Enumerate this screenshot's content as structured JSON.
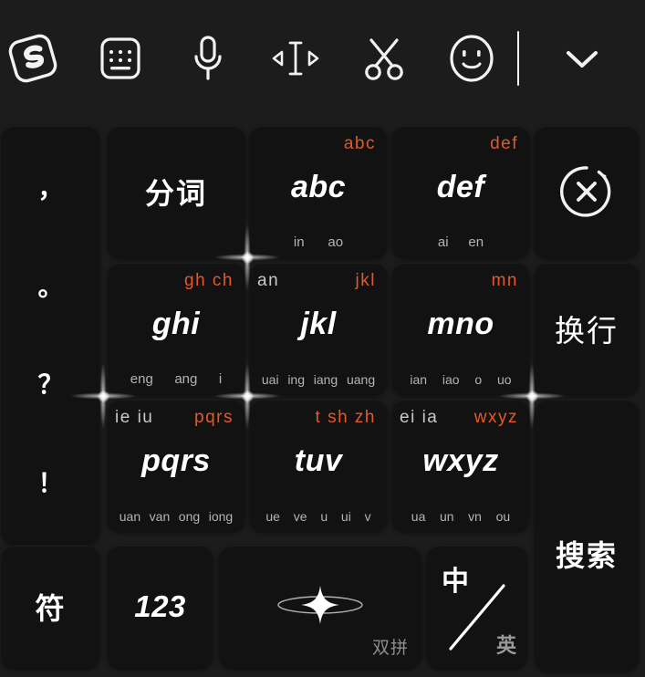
{
  "toolbar": {
    "items": [
      {
        "name": "sogou-logo-icon",
        "label": "S"
      },
      {
        "name": "keyboard-layout-icon",
        "label": "keyboard"
      },
      {
        "name": "voice-input-icon",
        "label": "microphone"
      },
      {
        "name": "cursor-move-icon",
        "label": "cursor-move"
      },
      {
        "name": "clipboard-cut-icon",
        "label": "scissors"
      },
      {
        "name": "emoji-icon",
        "label": "smiley"
      },
      {
        "name": "collapse-keyboard-icon",
        "label": "chevron-down"
      }
    ]
  },
  "keyboard": {
    "punctuation_key": {
      "marks": [
        "，",
        "。",
        "？",
        "！"
      ]
    },
    "keys": {
      "fenci": {
        "label": "分词"
      },
      "abc": {
        "top_right": "abc",
        "top_left": "",
        "main": "abc",
        "bottom": [
          "in",
          "ao"
        ]
      },
      "def": {
        "top_right": "def",
        "top_left": "",
        "main": "def",
        "bottom": [
          "ai",
          "en"
        ]
      },
      "ghi": {
        "top_right": "gh ch",
        "top_left": "",
        "main": "ghi",
        "bottom": [
          "eng",
          "ang",
          "i"
        ]
      },
      "jkl": {
        "top_right": "jkl",
        "top_left": "an",
        "main": "jkl",
        "bottom": [
          "uai",
          "ing",
          "iang",
          "uang"
        ]
      },
      "mno": {
        "top_right": "mn",
        "top_left": "",
        "main": "mno",
        "bottom": [
          "ian",
          "iao",
          "o",
          "uo"
        ]
      },
      "pqrs": {
        "top_right": "pqrs",
        "top_left": "ie iu",
        "main": "pqrs",
        "bottom": [
          "uan",
          "van",
          "ong",
          "iong"
        ]
      },
      "tuv": {
        "top_right": "t sh zh",
        "top_left": "",
        "main": "tuv",
        "bottom": [
          "ue",
          "ve",
          "u",
          "ui",
          "v"
        ]
      },
      "wxyz": {
        "top_right": "wxyz",
        "top_left": "ei ia",
        "main": "wxyz",
        "bottom": [
          "ua",
          "un",
          "vn",
          "ou"
        ]
      },
      "delete": {
        "label": "delete-icon"
      },
      "newline": {
        "label": "换行"
      },
      "search": {
        "label": "搜索"
      },
      "symbol": {
        "label": "符"
      },
      "numbers": {
        "label": "123"
      },
      "space": {
        "label": "双拼"
      },
      "lang_toggle": {
        "primary": "中",
        "secondary": "英"
      }
    }
  },
  "colors": {
    "accent_orange": "#e3592a",
    "key_bg": "#121212",
    "board_bg": "#1c1c1c",
    "text_primary": "#ffffff",
    "text_secondary": "#b4b4b4"
  }
}
